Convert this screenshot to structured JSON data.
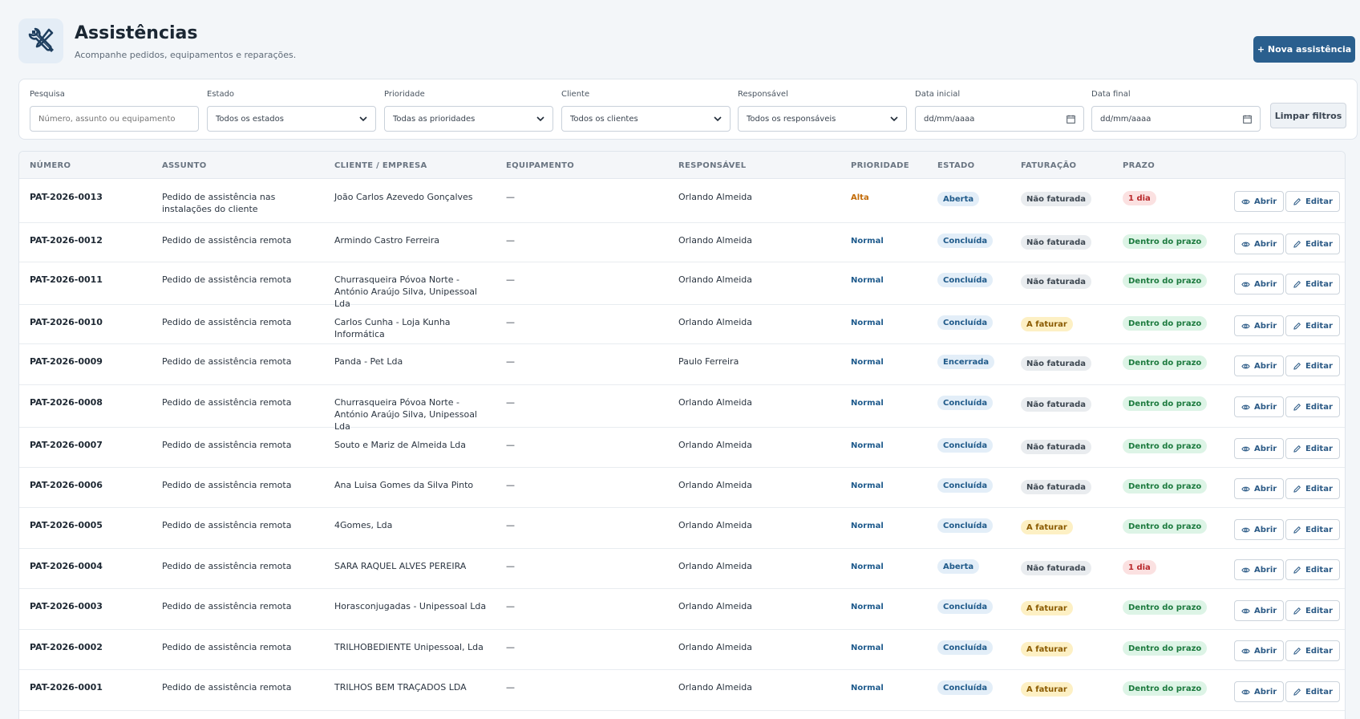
{
  "header": {
    "title": "Assistências",
    "subtitle": "Acompanhe pedidos, equipamentos e reparações.",
    "new_button": "+ Nova assistência",
    "icon": "tools-icon"
  },
  "filters": {
    "search": {
      "label": "Pesquisa",
      "placeholder": "Número, assunto ou equipamento"
    },
    "estado": {
      "label": "Estado",
      "value": "Todos os estados"
    },
    "prioridade": {
      "label": "Prioridade",
      "value": "Todas as prioridades"
    },
    "cliente": {
      "label": "Cliente",
      "value": "Todos os clientes"
    },
    "responsavel": {
      "label": "Responsável",
      "value": "Todos os responsáveis"
    },
    "data_inicial": {
      "label": "Data inicial",
      "value": "dd/mm/aaaa"
    },
    "data_final": {
      "label": "Data final",
      "value": "dd/mm/aaaa"
    },
    "clear_button": "Limpar filtros"
  },
  "table": {
    "columns": [
      "NÚMERO",
      "ASSUNTO",
      "CLIENTE / EMPRESA",
      "EQUIPAMENTO",
      "RESPONSÁVEL",
      "PRIORIDADE",
      "ESTADO",
      "FATURAÇÃO",
      "PRAZO"
    ],
    "open_label": "Abrir",
    "edit_label": "Editar",
    "rows": [
      {
        "numero": "PAT-2026-0013",
        "assunto": "Pedido de assistência nas instalações do cliente",
        "cliente": "João Carlos Azevedo Gonçalves",
        "equipamento": "—",
        "responsavel": "Orlando Almeida",
        "prioridade": "Alta",
        "estado": "Aberta",
        "faturacao": "Não faturada",
        "prazo": "1 dia"
      },
      {
        "numero": "PAT-2026-0012",
        "assunto": "Pedido de assistência remota",
        "cliente": "Armindo Castro Ferreira",
        "equipamento": "—",
        "responsavel": "Orlando Almeida",
        "prioridade": "Normal",
        "estado": "Concluída",
        "faturacao": "Não faturada",
        "prazo": "Dentro do prazo"
      },
      {
        "numero": "PAT-2026-0011",
        "assunto": "Pedido de assistência remota",
        "cliente": "Churrasqueira Póvoa Norte - António Araújo Silva, Unipessoal Lda",
        "equipamento": "—",
        "responsavel": "Orlando Almeida",
        "prioridade": "Normal",
        "estado": "Concluída",
        "faturacao": "Não faturada",
        "prazo": "Dentro do prazo"
      },
      {
        "numero": "PAT-2026-0010",
        "assunto": "Pedido de assistência remota",
        "cliente": "Carlos Cunha - Loja Kunha Informática",
        "equipamento": "—",
        "responsavel": "Orlando Almeida",
        "prioridade": "Normal",
        "estado": "Concluída",
        "faturacao": "A faturar",
        "prazo": "Dentro do prazo"
      },
      {
        "numero": "PAT-2026-0009",
        "assunto": "Pedido de assistência remota",
        "cliente": "Panda - Pet Lda",
        "equipamento": "—",
        "responsavel": "Paulo Ferreira",
        "prioridade": "Normal",
        "estado": "Encerrada",
        "faturacao": "Não faturada",
        "prazo": "Dentro do prazo"
      },
      {
        "numero": "PAT-2026-0008",
        "assunto": "Pedido de assistência remota",
        "cliente": "Churrasqueira Póvoa Norte - António Araújo Silva, Unipessoal Lda",
        "equipamento": "—",
        "responsavel": "Orlando Almeida",
        "prioridade": "Normal",
        "estado": "Concluída",
        "faturacao": "Não faturada",
        "prazo": "Dentro do prazo"
      },
      {
        "numero": "PAT-2026-0007",
        "assunto": "Pedido de assistência remota",
        "cliente": "Souto e Mariz de Almeida Lda",
        "equipamento": "—",
        "responsavel": "Orlando Almeida",
        "prioridade": "Normal",
        "estado": "Concluída",
        "faturacao": "Não faturada",
        "prazo": "Dentro do prazo"
      },
      {
        "numero": "PAT-2026-0006",
        "assunto": "Pedido de assistência remota",
        "cliente": "Ana Luisa Gomes da Silva Pinto",
        "equipamento": "—",
        "responsavel": "Orlando Almeida",
        "prioridade": "Normal",
        "estado": "Concluída",
        "faturacao": "Não faturada",
        "prazo": "Dentro do prazo"
      },
      {
        "numero": "PAT-2026-0005",
        "assunto": "Pedido de assistência remota",
        "cliente": "4Gomes, Lda",
        "equipamento": "—",
        "responsavel": "Orlando Almeida",
        "prioridade": "Normal",
        "estado": "Concluída",
        "faturacao": "A faturar",
        "prazo": "Dentro do prazo"
      },
      {
        "numero": "PAT-2026-0004",
        "assunto": "Pedido de assistência remota",
        "cliente": "SARA RAQUEL ALVES PEREIRA",
        "equipamento": "—",
        "responsavel": "Orlando Almeida",
        "prioridade": "Normal",
        "estado": "Aberta",
        "faturacao": "Não faturada",
        "prazo": "1 dia"
      },
      {
        "numero": "PAT-2026-0003",
        "assunto": "Pedido de assistência remota",
        "cliente": "Horasconjugadas - Unipessoal Lda",
        "equipamento": "—",
        "responsavel": "Orlando Almeida",
        "prioridade": "Normal",
        "estado": "Concluída",
        "faturacao": "A faturar",
        "prazo": "Dentro do prazo"
      },
      {
        "numero": "PAT-2026-0002",
        "assunto": "Pedido de assistência remota",
        "cliente": "TRILHOBEDIENTE Unipessoal, Lda",
        "equipamento": "—",
        "responsavel": "Orlando Almeida",
        "prioridade": "Normal",
        "estado": "Concluída",
        "faturacao": "A faturar",
        "prazo": "Dentro do prazo"
      },
      {
        "numero": "PAT-2026-0001",
        "assunto": "Pedido de assistência remota",
        "cliente": "TRILHOS BEM TRAÇADOS LDA",
        "equipamento": "—",
        "responsavel": "Orlando Almeida",
        "prioridade": "Normal",
        "estado": "Concluída",
        "faturacao": "A faturar",
        "prazo": "Dentro do prazo"
      }
    ]
  },
  "colors": {
    "primary": "#2a5f8e",
    "priority_high": "#c26a06",
    "priority_normal": "#1e5a8c",
    "late": "#b8282b",
    "ok": "#1c7a3e"
  }
}
